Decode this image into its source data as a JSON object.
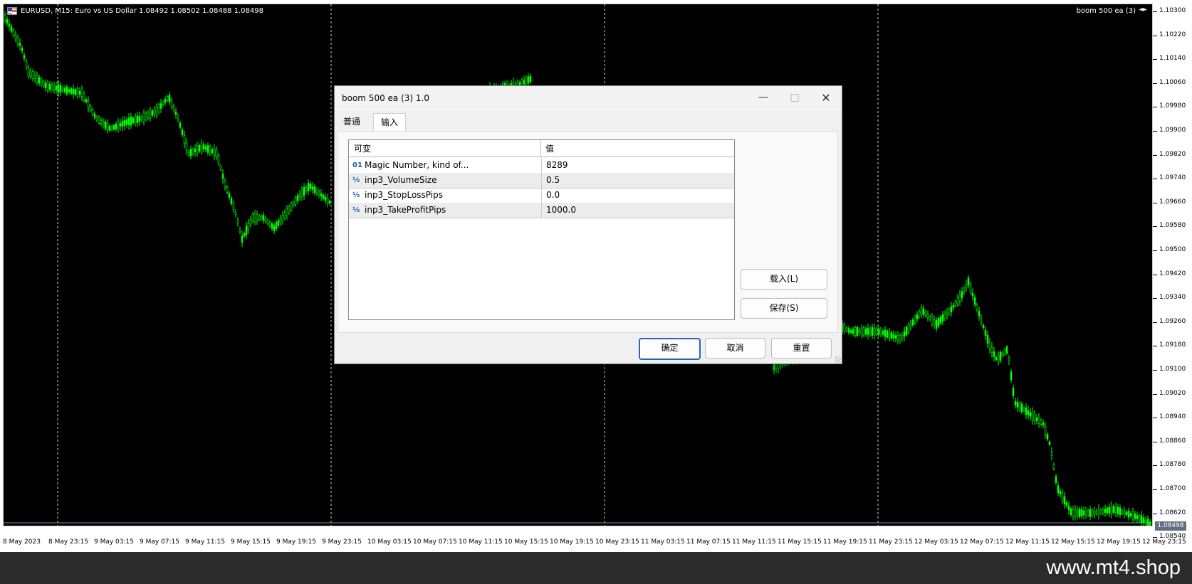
{
  "chart": {
    "symbol_line": "EURUSD, M15:  Euro vs US Dollar  1.08492 1.08502 1.08488 1.08498",
    "ea_name": "boom 500 ea (3)",
    "current_price": "1.08498",
    "price_scale": [
      "1.10300",
      "1.10220",
      "1.10140",
      "1.10060",
      "1.09980",
      "1.09900",
      "1.09820",
      "1.09740",
      "1.09660",
      "1.09580",
      "1.09500",
      "1.09420",
      "1.09340",
      "1.09260",
      "1.09180",
      "1.09100",
      "1.09020",
      "1.08940",
      "1.08860",
      "1.08780",
      "1.08700",
      "1.08620",
      "1.08540"
    ],
    "time_axis": [
      "8 May 2023",
      "8 May 23:15",
      "9 May 03:15",
      "9 May 07:15",
      "9 May 11:15",
      "9 May 15:15",
      "9 May 19:15",
      "9 May 23:15",
      "10 May 03:15",
      "10 May 07:15",
      "10 May 11:15",
      "10 May 15:15",
      "10 May 19:15",
      "10 May 23:15",
      "11 May 03:15",
      "11 May 07:15",
      "11 May 11:15",
      "11 May 15:15",
      "11 May 19:15",
      "11 May 23:15",
      "12 May 03:15",
      "12 May 07:15",
      "12 May 11:15",
      "12 May 15:15",
      "12 May 19:15",
      "12 May 23:15"
    ],
    "candle_color": "#00ff00",
    "background": "#000000"
  },
  "dialog": {
    "title": "boom 500 ea (3) 1.0",
    "tabs": [
      "普通",
      "输入"
    ],
    "active_tab": "输入",
    "columns": {
      "variable": "可变",
      "value": "值"
    },
    "params": [
      {
        "icon": "01",
        "name": "Magic Number, kind of...",
        "value": "8289"
      },
      {
        "icon": "½",
        "name": "inp3_VolumeSize",
        "value": "0.5"
      },
      {
        "icon": "½",
        "name": "inp3_StopLossPips",
        "value": "0.0"
      },
      {
        "icon": "½",
        "name": "inp3_TakeProfitPips",
        "value": "1000.0"
      }
    ],
    "load_button": "载入(L)",
    "save_button": "保存(S)",
    "ok_button": "确定",
    "cancel_button": "取消",
    "reset_button": "重置"
  },
  "watermark": "www.mt4.shop"
}
